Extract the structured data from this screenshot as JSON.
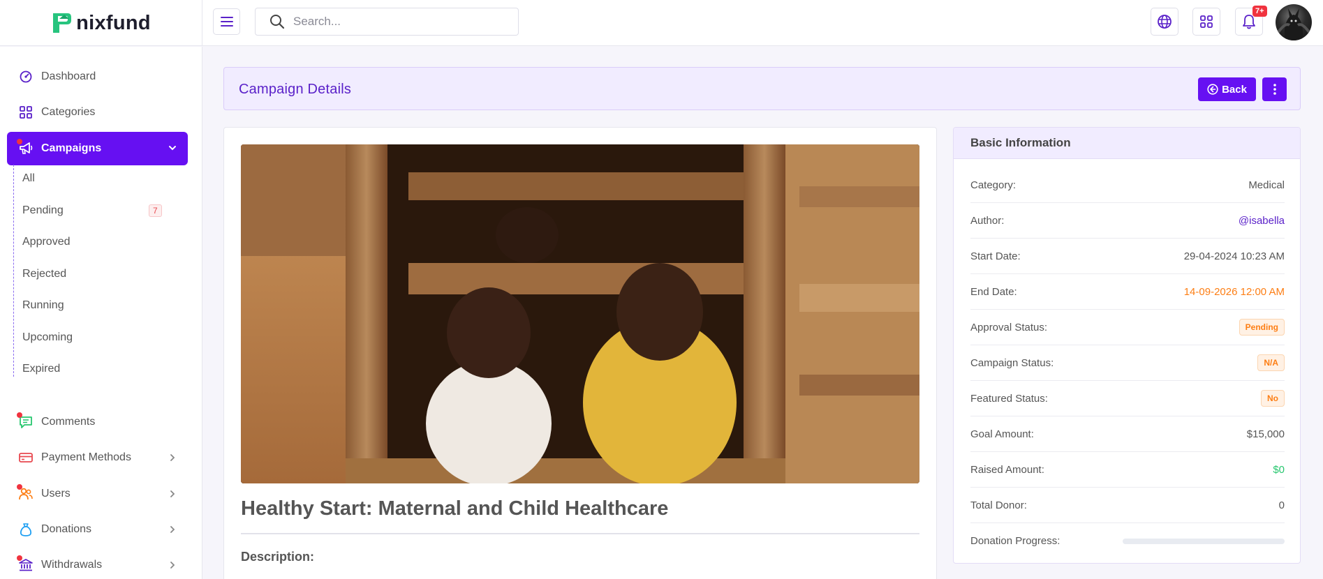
{
  "brand": {
    "name": "nixfund"
  },
  "header": {
    "search_placeholder": "Search...",
    "notification_count": "7+"
  },
  "sidebar": {
    "items": [
      {
        "label": "Dashboard"
      },
      {
        "label": "Categories"
      },
      {
        "label": "Campaigns"
      },
      {
        "label": "Comments"
      },
      {
        "label": "Payment Methods"
      },
      {
        "label": "Users"
      },
      {
        "label": "Donations"
      },
      {
        "label": "Withdrawals"
      }
    ],
    "campaign_sub": [
      {
        "label": "All"
      },
      {
        "label": "Pending",
        "badge": "7"
      },
      {
        "label": "Approved"
      },
      {
        "label": "Rejected"
      },
      {
        "label": "Running"
      },
      {
        "label": "Upcoming"
      },
      {
        "label": "Expired"
      }
    ]
  },
  "page": {
    "title": "Campaign Details",
    "back_label": "Back"
  },
  "campaign": {
    "title": "Healthy Start: Maternal and Child Healthcare",
    "description_label": "Description:"
  },
  "info": {
    "heading": "Basic Information",
    "rows": [
      {
        "label": "Category:",
        "value": "Medical"
      },
      {
        "label": "Author:",
        "value": "@isabella"
      },
      {
        "label": "Start Date:",
        "value": "29-04-2024 10:23 AM"
      },
      {
        "label": "End Date:",
        "value": "14-09-2026 12:00 AM"
      },
      {
        "label": "Approval Status:",
        "value": "Pending"
      },
      {
        "label": "Campaign Status:",
        "value": "N/A"
      },
      {
        "label": "Featured Status:",
        "value": "No"
      },
      {
        "label": "Goal Amount:",
        "value": "$15,000"
      },
      {
        "label": "Raised Amount:",
        "value": "$0"
      },
      {
        "label": "Total Donor:",
        "value": "0"
      },
      {
        "label": "Donation Progress:",
        "progress": 0
      }
    ]
  },
  "colors": {
    "primary": "#6610f2",
    "accent_orange": "#fd7e14",
    "success": "#28c76f",
    "danger": "#f0333f"
  }
}
